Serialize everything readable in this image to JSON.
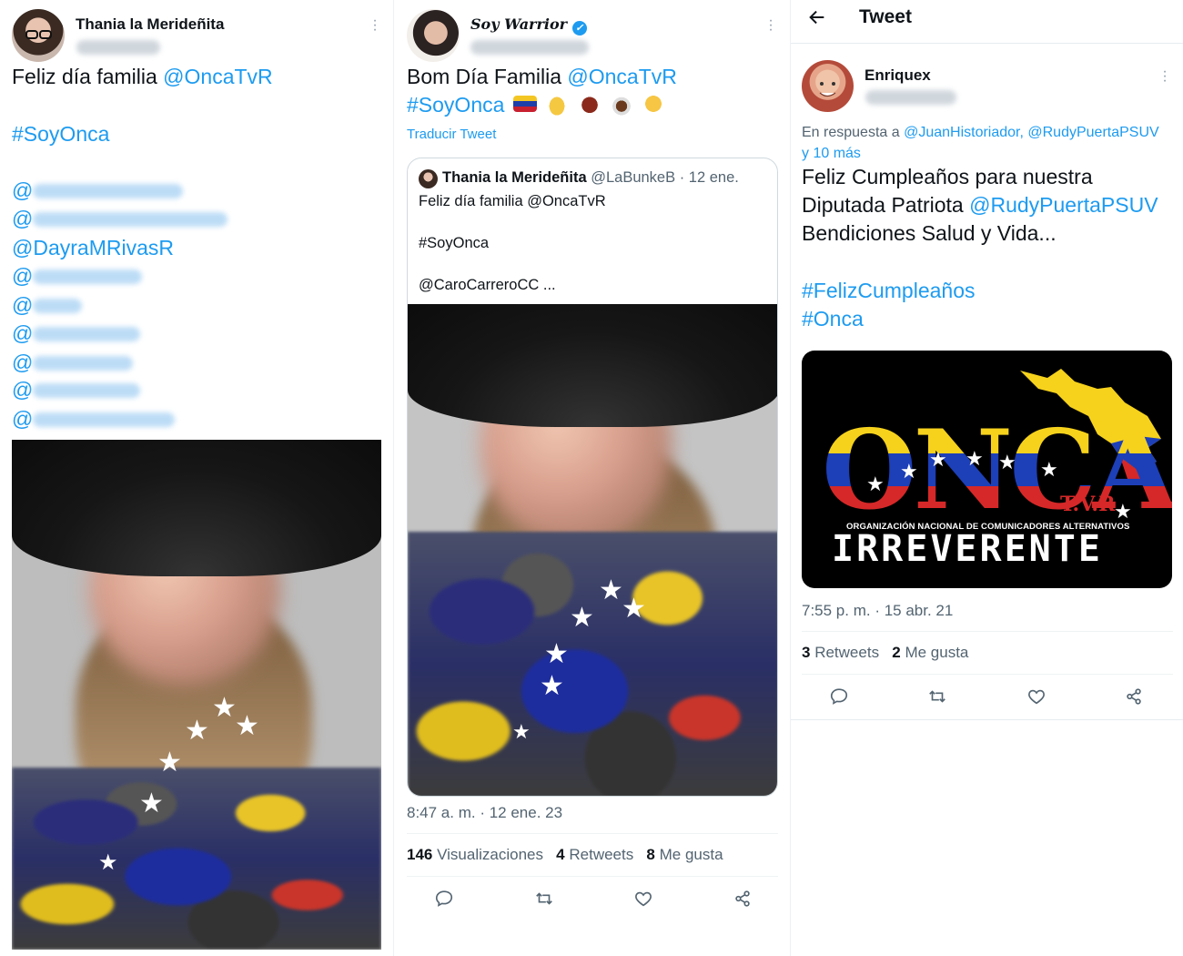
{
  "colors": {
    "link": "#1d9bf0",
    "muted": "#536471",
    "text": "#0f1419"
  },
  "panel1": {
    "author_name": "Thania la Merideñita",
    "line1_text": "Feliz día familia ",
    "line1_mention": "@OncaTvR",
    "hashtag": "#SoyOnca",
    "mention_visible": "@DayraMRivasR",
    "mention_prefix": "@"
  },
  "panel2": {
    "author_name_italic1": "Soy",
    "author_name_italic2": "Warrior",
    "verified_icon": "verified-badge-icon",
    "line1_text": "Bom Día Familia ",
    "line1_mention": "@OncaTvR",
    "hashtag": "#SoyOnca",
    "translate": "Traducir Tweet",
    "quote": {
      "author_name": "Thania la Merideñita",
      "handle": "@LaBunkeB",
      "date": "· 12 ene.",
      "line1": "Feliz día familia @OncaTvR",
      "line2": "#SoyOnca",
      "line3": "@CaroCarreroCC ..."
    },
    "timestamp": "8:47 a. m. · 12 ene. 23",
    "stats": {
      "views_count": "146",
      "views_label": "Visualizaciones",
      "retweets_count": "4",
      "retweets_label": "Retweets",
      "likes_count": "8",
      "likes_label": "Me gusta"
    }
  },
  "panel3": {
    "header_title": "Tweet",
    "author_name": "Enriquex",
    "reply_prefix": "En respuesta a ",
    "reply_mentions": "@JuanHistoriador, @RudyPuertaPSUV",
    "reply_more": "y 10 más",
    "body_line1": "Feliz Cumpleaños para nuestra",
    "body_line2a": "Diputada Patriota ",
    "body_line2b": "@RudyPuertaPSUV",
    "body_line3": "Bendiciones Salud y Vida...",
    "hashtag1": "#FelizCumpleaños",
    "hashtag2": "#Onca",
    "logo": {
      "letters": "ONCA",
      "tvr": "T.V.R",
      "subtitle": "ORGANIZACIÓN NACIONAL DE COMUNICADORES ALTERNATIVOS",
      "big": "IRREVERENTE"
    },
    "timestamp": "7:55 p. m. · 15 abr. 21",
    "stats": {
      "retweets_count": "3",
      "retweets_label": "Retweets",
      "likes_count": "2",
      "likes_label": "Me gusta"
    }
  }
}
